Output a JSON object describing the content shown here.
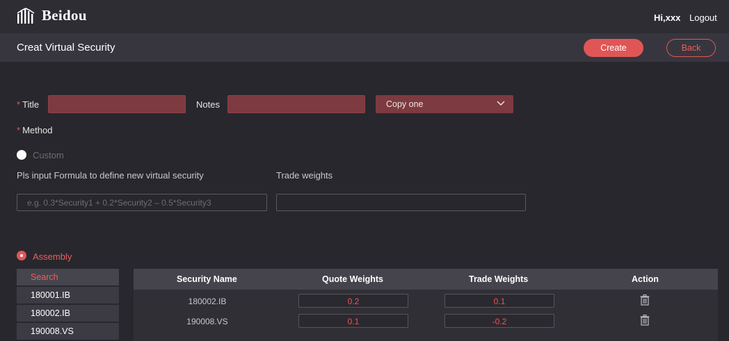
{
  "header": {
    "brand": "Beidou",
    "greeting": "Hi,xxx",
    "logout": "Logout"
  },
  "subheader": {
    "title": "Creat Virtual Security",
    "create_label": "Create",
    "back_label": "Back"
  },
  "form": {
    "title_label": "Title",
    "notes_label": "Notes",
    "copy_select": "Copy one",
    "method_label": "Method",
    "custom_option": "Custom",
    "formula_label": "Pls input Formula to define new virtual security",
    "formula_placeholder": "e.g. 0.3*Security1 + 0.2*Security2 – 0.5*Security3",
    "trade_weights_label": "Trade weights",
    "assembly_option": "Assembly"
  },
  "search_list": {
    "search_label": "Search",
    "items": [
      "180001.IB",
      "180002.IB",
      "190008.VS"
    ]
  },
  "table": {
    "columns": [
      "Security Name",
      "Quote Weights",
      "Trade Weights",
      "Action"
    ],
    "rows": [
      {
        "name": "180002.IB",
        "quote": "0.2",
        "trade": "0.1"
      },
      {
        "name": "190008.VS",
        "quote": "0.1",
        "trade": "-0.2"
      }
    ]
  },
  "colors": {
    "accent": "#e05656",
    "input_fill": "#7d3a40",
    "background": "#28272d"
  },
  "icons": {
    "logo": "building-bars-icon",
    "dropdown": "chevron-down-icon",
    "delete": "trash-icon"
  }
}
